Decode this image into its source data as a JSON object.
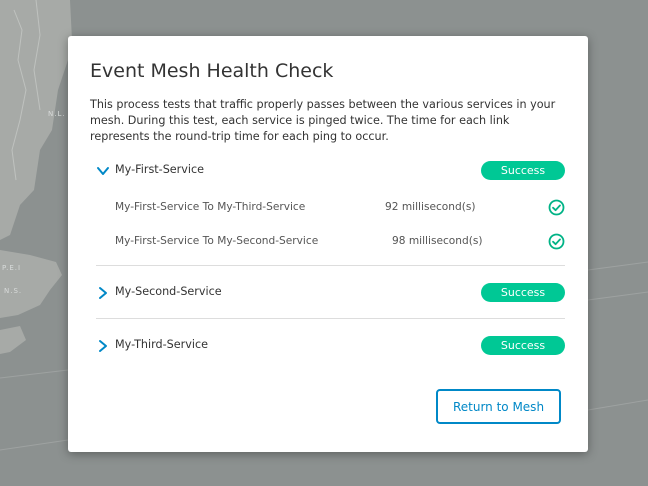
{
  "map": {
    "labels": [
      "N.L.",
      "P.E.I",
      "N.S."
    ]
  },
  "dialog": {
    "title": "Event Mesh Health Check",
    "description": "This process tests that traffic properly passes between the various services in your mesh. During this test, each service is pinged twice. The time for each link represents the round-trip time for each ping to occur.",
    "services": [
      {
        "name": "My-First-Service",
        "status": "Success",
        "expanded": true,
        "links": [
          {
            "name": "My-First-Service To My-Third-Service",
            "time": "92 millisecond(s)"
          },
          {
            "name": "My-First-Service To My-Second-Service",
            "time": "98 millisecond(s)"
          }
        ]
      },
      {
        "name": "My-Second-Service",
        "status": "Success",
        "expanded": false
      },
      {
        "name": "My-Third-Service",
        "status": "Success",
        "expanded": false
      }
    ],
    "return_label": "Return to Mesh"
  },
  "colors": {
    "success": "#00c895",
    "accent": "#0088c7",
    "backdrop": "#8c9190"
  },
  "icons": {
    "expanded": "chevron-down-icon",
    "collapsed": "chevron-right-icon",
    "link_ok": "check-circle-icon"
  }
}
